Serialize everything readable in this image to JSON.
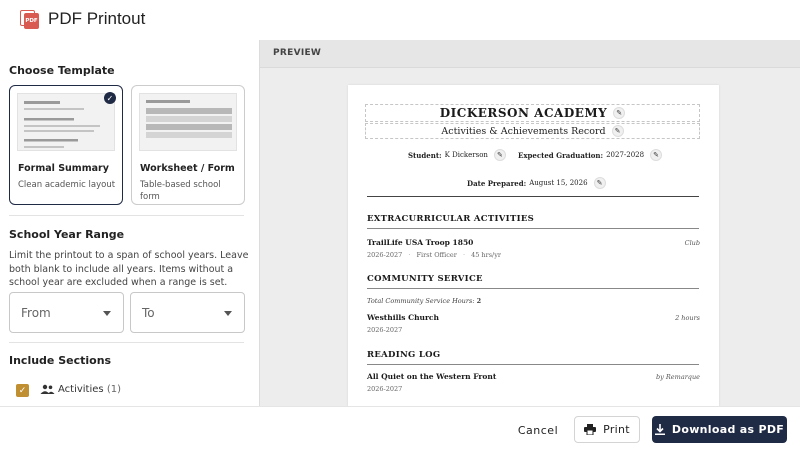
{
  "app": {
    "title": "PDF Printout",
    "logo_text": "PDF"
  },
  "left": {
    "choose_template": "Choose Template",
    "templates": [
      {
        "name": "Formal Summary",
        "desc": "Clean academic layout",
        "selected": true
      },
      {
        "name": "Worksheet / Form",
        "desc": "Table-based school form",
        "selected": false
      }
    ],
    "school_year_title": "School Year Range",
    "school_year_desc": "Limit the printout to a span of school years. Leave both blank to include all years. Items without a school year are excluded when a range is set.",
    "from_placeholder": "From",
    "to_placeholder": "To",
    "include_title": "Include Sections",
    "sections": [
      {
        "label": "Activities",
        "count": "(1)",
        "checked": true
      }
    ]
  },
  "preview": {
    "label": "PREVIEW",
    "school_name": "DICKERSON ACADEMY",
    "subtitle": "Activities & Achievements Record",
    "student_label": "Student:",
    "student_value": "K Dickerson",
    "grad_label": "Expected Graduation:",
    "grad_value": "2027-2028",
    "date_label": "Date Prepared:",
    "date_value": "August 15, 2026",
    "sections": {
      "extracurricular": {
        "title": "EXTRACURRICULAR ACTIVITIES",
        "item_title": "TrailLife USA Troop 1850",
        "item_right": "Club",
        "item_years": "2026-2027",
        "item_role": "First Officer",
        "item_hours": "45 hrs/yr",
        "sep": "·"
      },
      "community": {
        "title": "COMMUNITY SERVICE",
        "total_label": "Total Community Service Hours:",
        "total_value": "2",
        "item_title": "Westhills Church",
        "item_right": "2 hours",
        "item_years": "2026-2027"
      },
      "reading": {
        "title": "READING LOG",
        "item_title": "All Quiet on the Western Front",
        "item_right": "by Remarque",
        "item_years": "2026-2027"
      }
    }
  },
  "footer": {
    "cancel": "Cancel",
    "print": "Print",
    "download": "Download as PDF"
  },
  "colors": {
    "navy": "#1f2a44",
    "gold": "#c08f32",
    "pdf_red": "#d95a50"
  }
}
